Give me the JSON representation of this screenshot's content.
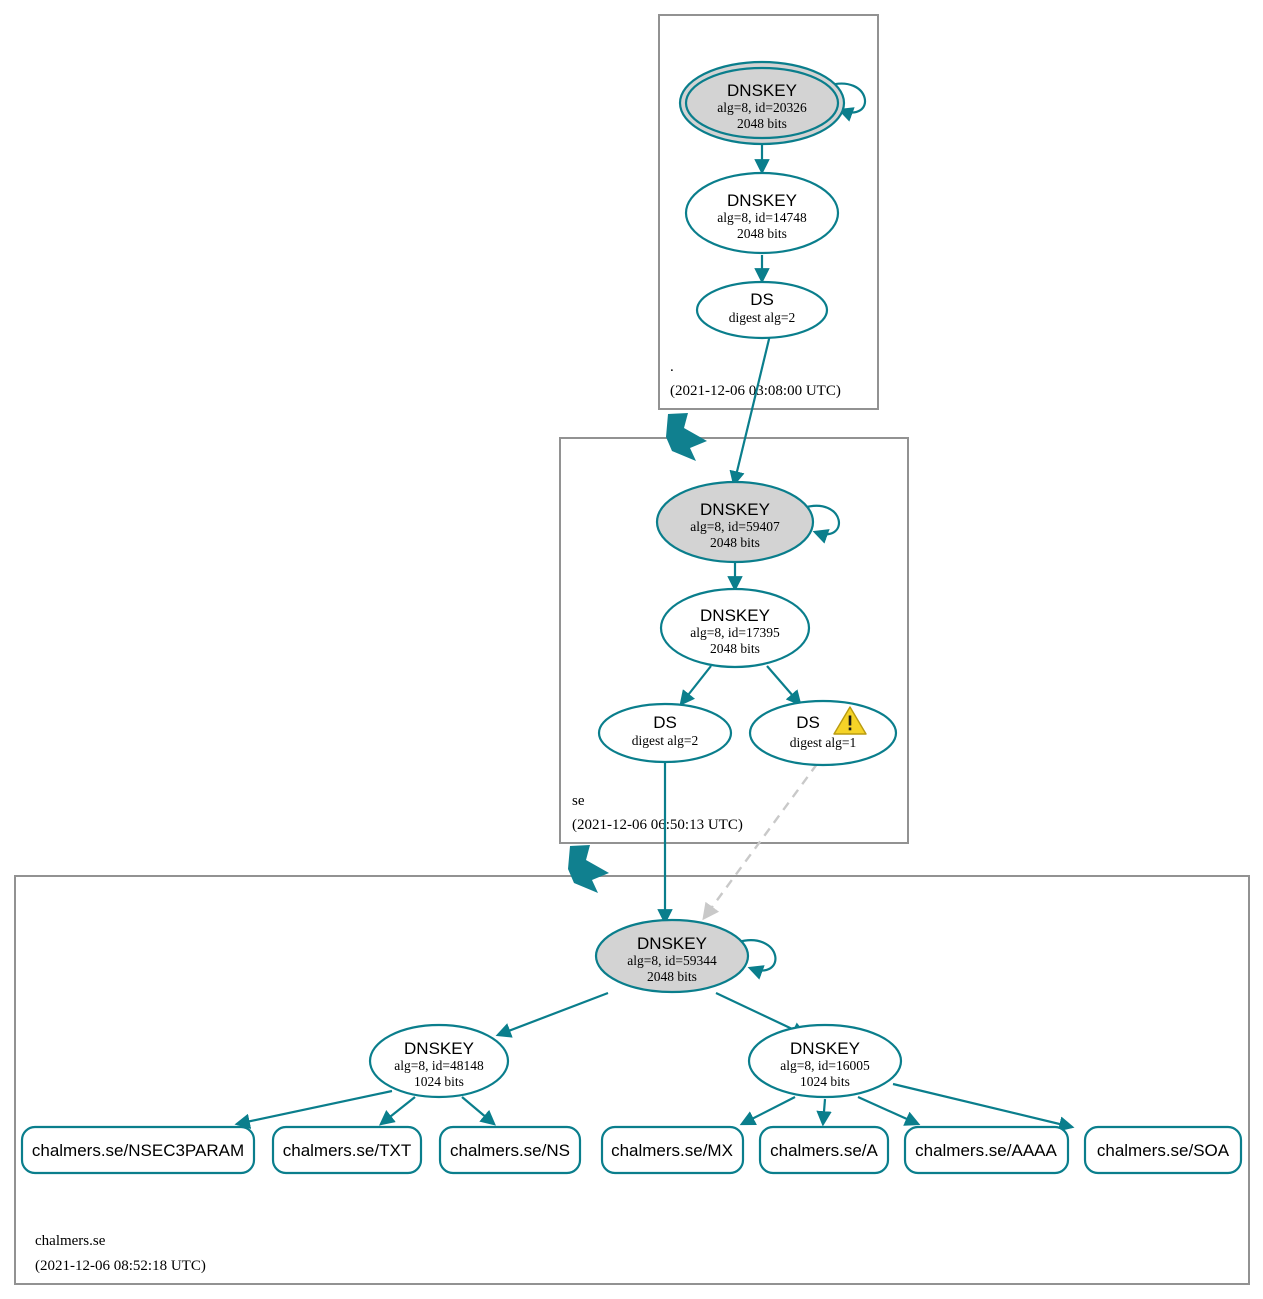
{
  "diagram": {
    "type": "dnssec-authentication-chain",
    "colors": {
      "accent_teal": "#0a7e8c",
      "secure_node_fill": "#d3d3d3",
      "zone_border": "#929292",
      "warning_yellow": "#f5d327",
      "dashed_gray": "#c9c9c9"
    }
  },
  "zones": [
    {
      "id": "root",
      "name": ".",
      "timestamp": "(2021-12-06 03:08:00 UTC)"
    },
    {
      "id": "se",
      "name": "se",
      "timestamp": "(2021-12-06 06:50:13 UTC)"
    },
    {
      "id": "chalmers",
      "name": "chalmers.se",
      "timestamp": "(2021-12-06 08:52:18 UTC)"
    }
  ],
  "nodes": {
    "root_ksk": {
      "title": "DNSKEY",
      "line2": "alg=8, id=20326",
      "line3": "2048 bits"
    },
    "root_zsk": {
      "title": "DNSKEY",
      "line2": "alg=8, id=14748",
      "line3": "2048 bits"
    },
    "root_ds": {
      "title": "DS",
      "line2": "digest alg=2"
    },
    "se_ksk": {
      "title": "DNSKEY",
      "line2": "alg=8, id=59407",
      "line3": "2048 bits"
    },
    "se_zsk": {
      "title": "DNSKEY",
      "line2": "alg=8, id=17395",
      "line3": "2048 bits"
    },
    "se_ds_2": {
      "title": "DS",
      "line2": "digest alg=2"
    },
    "se_ds_1": {
      "title": "DS",
      "line2": "digest alg=1",
      "warning": true
    },
    "chalmers_ksk": {
      "title": "DNSKEY",
      "line2": "alg=8, id=59344",
      "line3": "2048 bits"
    },
    "chalmers_zsk_left": {
      "title": "DNSKEY",
      "line2": "alg=8, id=48148",
      "line3": "1024 bits"
    },
    "chalmers_zsk_right": {
      "title": "DNSKEY",
      "line2": "alg=8, id=16005",
      "line3": "1024 bits"
    }
  },
  "rrsets": [
    {
      "id": "nsec3param",
      "label": "chalmers.se/NSEC3PARAM"
    },
    {
      "id": "txt",
      "label": "chalmers.se/TXT"
    },
    {
      "id": "ns",
      "label": "chalmers.se/NS"
    },
    {
      "id": "mx",
      "label": "chalmers.se/MX"
    },
    {
      "id": "a",
      "label": "chalmers.se/A"
    },
    {
      "id": "aaaa",
      "label": "chalmers.se/AAAA"
    },
    {
      "id": "soa",
      "label": "chalmers.se/SOA"
    }
  ]
}
